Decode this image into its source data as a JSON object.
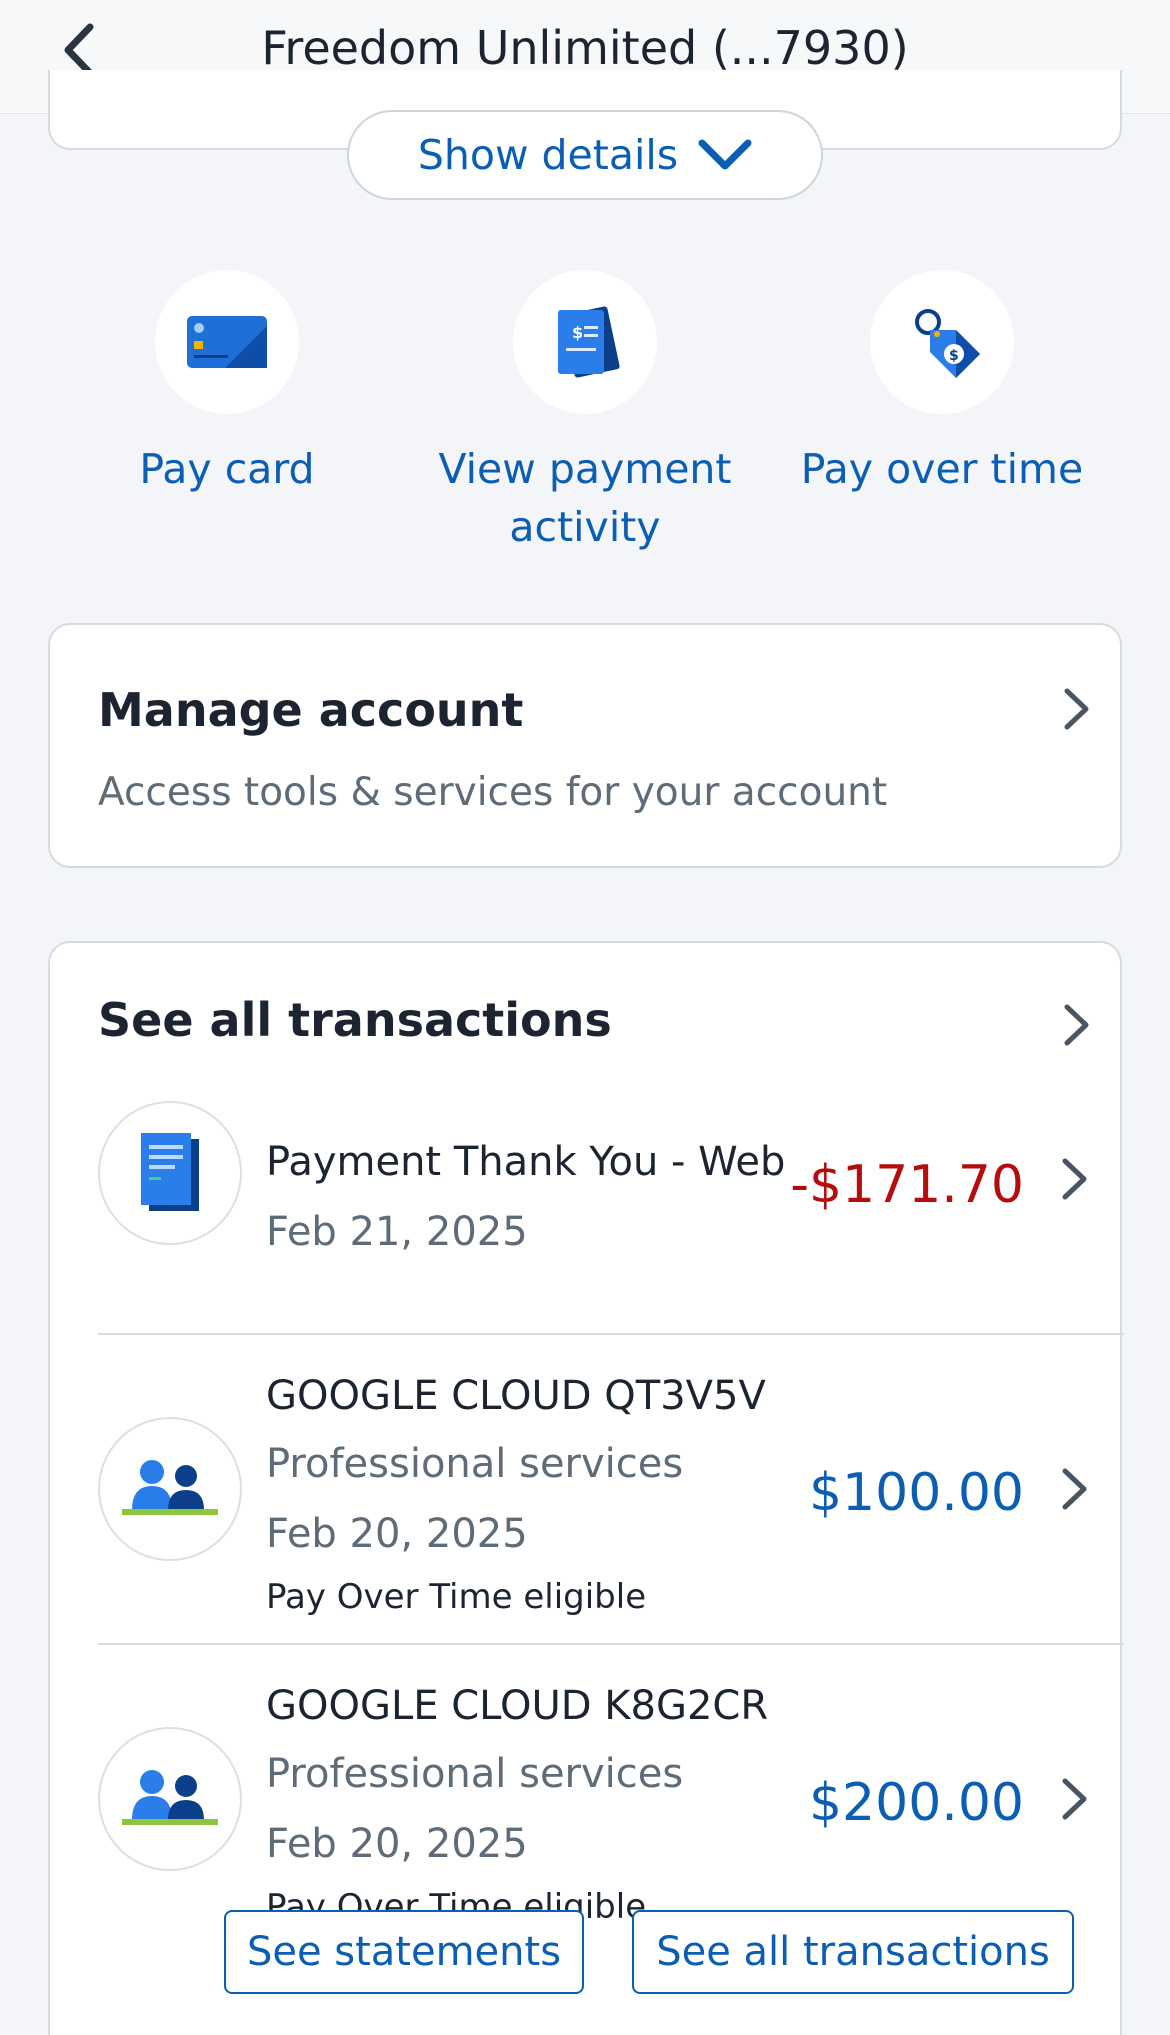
{
  "header": {
    "title": "Freedom Unlimited (...7930)"
  },
  "show_details": {
    "label": "Show details"
  },
  "actions": [
    {
      "label_line1": "Pay card",
      "label_line2": "",
      "icon": "credit-card-icon"
    },
    {
      "label_line1": "View payment",
      "label_line2": "activity",
      "icon": "payment-document-icon"
    },
    {
      "label_line1": "Pay over time",
      "label_line2": "",
      "icon": "price-tag-icon"
    }
  ],
  "manage": {
    "title": "Manage account",
    "subtitle": "Access tools & services for your account"
  },
  "transactions": {
    "title": "See all transactions",
    "items": [
      {
        "name": "Payment Thank You - Web",
        "category": "",
        "date": "Feb 21, 2025",
        "extra": "",
        "amount": "-$171.70",
        "icon": "document-icon"
      },
      {
        "name": "GOOGLE CLOUD QT3V5V",
        "category": "Professional services",
        "date": "Feb 20, 2025",
        "extra": "Pay Over Time eligible",
        "amount": "$100.00",
        "icon": "people-icon"
      },
      {
        "name": "GOOGLE CLOUD K8G2CR",
        "category": "Professional services",
        "date": "Feb 20, 2025",
        "extra": "Pay Over Time eligible",
        "amount": "$200.00",
        "icon": "people-icon"
      }
    ]
  },
  "buttons": {
    "statements": "See statements",
    "all_transactions": "See all transactions"
  },
  "colors": {
    "accent": "#0b5eb3",
    "negative": "#b50d0d",
    "background": "#f3f5f8"
  }
}
